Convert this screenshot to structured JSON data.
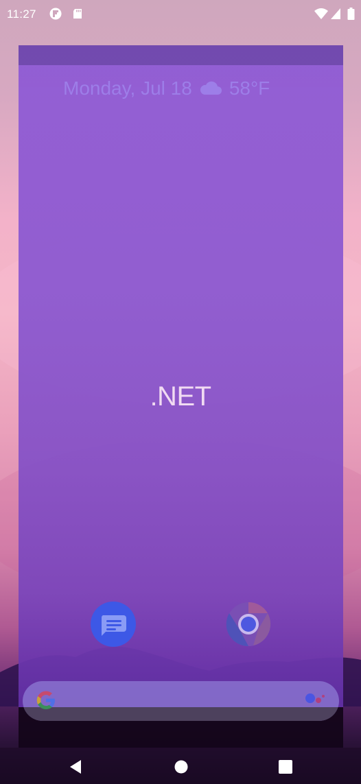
{
  "status_bar": {
    "time": "11:27",
    "notification_icons": [
      "flipboard-icon",
      "sd-card-icon"
    ],
    "system_icons": [
      "wifi-icon",
      "cell-signal-icon",
      "battery-icon"
    ]
  },
  "home": {
    "date": "Monday, Jul 18",
    "weather_icon": "cloud-icon",
    "temperature": "58°F"
  },
  "app_overlay": {
    "title": ".NET",
    "background_color": "#8a57d0",
    "titlebar_color": "#6b44ae"
  },
  "dock": {
    "apps": [
      {
        "name": "Messages",
        "icon": "messages-icon"
      },
      {
        "name": "Chrome",
        "icon": "chrome-icon"
      }
    ]
  },
  "search": {
    "google_icon": "google-g-icon",
    "assistant_icon": "google-assistant-icon"
  },
  "navigation": {
    "buttons": [
      "back-icon",
      "home-icon",
      "recents-icon"
    ]
  }
}
